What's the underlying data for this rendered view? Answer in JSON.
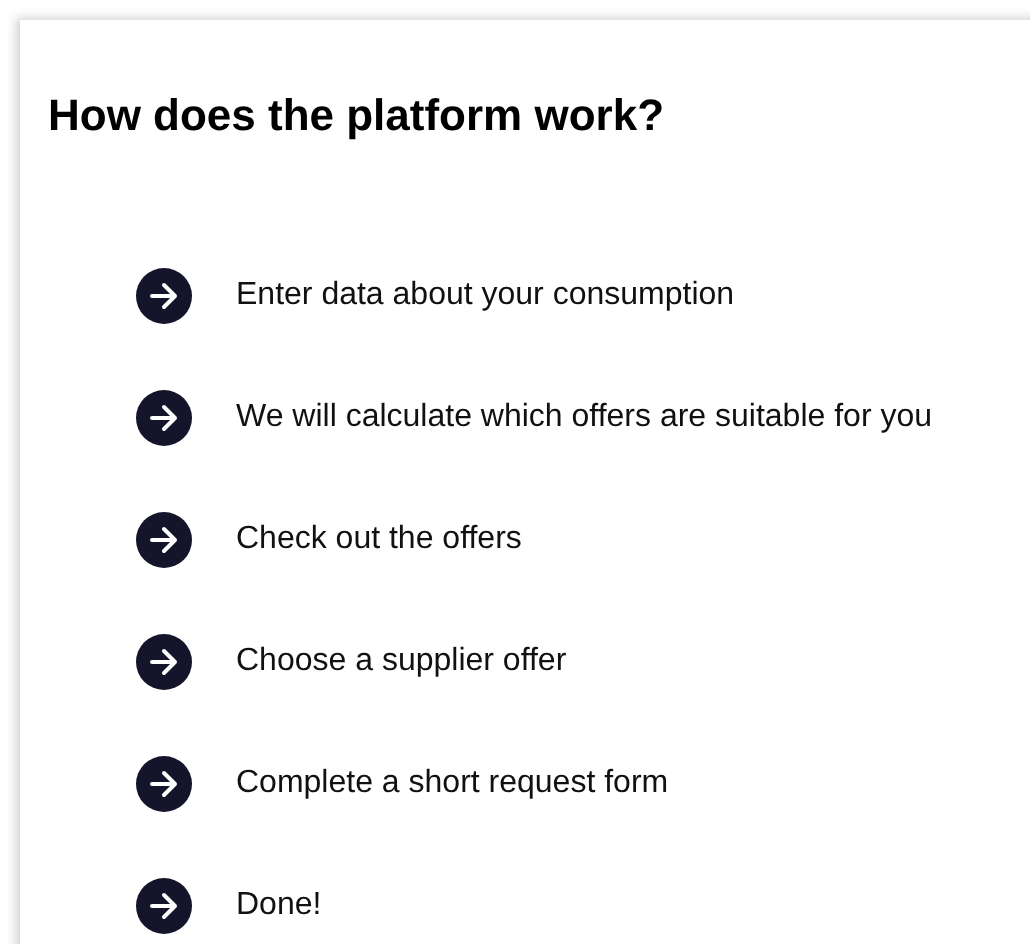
{
  "title": "How does the platform work?",
  "steps": [
    {
      "text": "Enter data about your consumption"
    },
    {
      "text": "We will calculate which offers are suitable for you"
    },
    {
      "text": "Check out the offers"
    },
    {
      "text": "Choose a supplier offer"
    },
    {
      "text": "Complete a short request form"
    },
    {
      "text": "Done!"
    }
  ]
}
